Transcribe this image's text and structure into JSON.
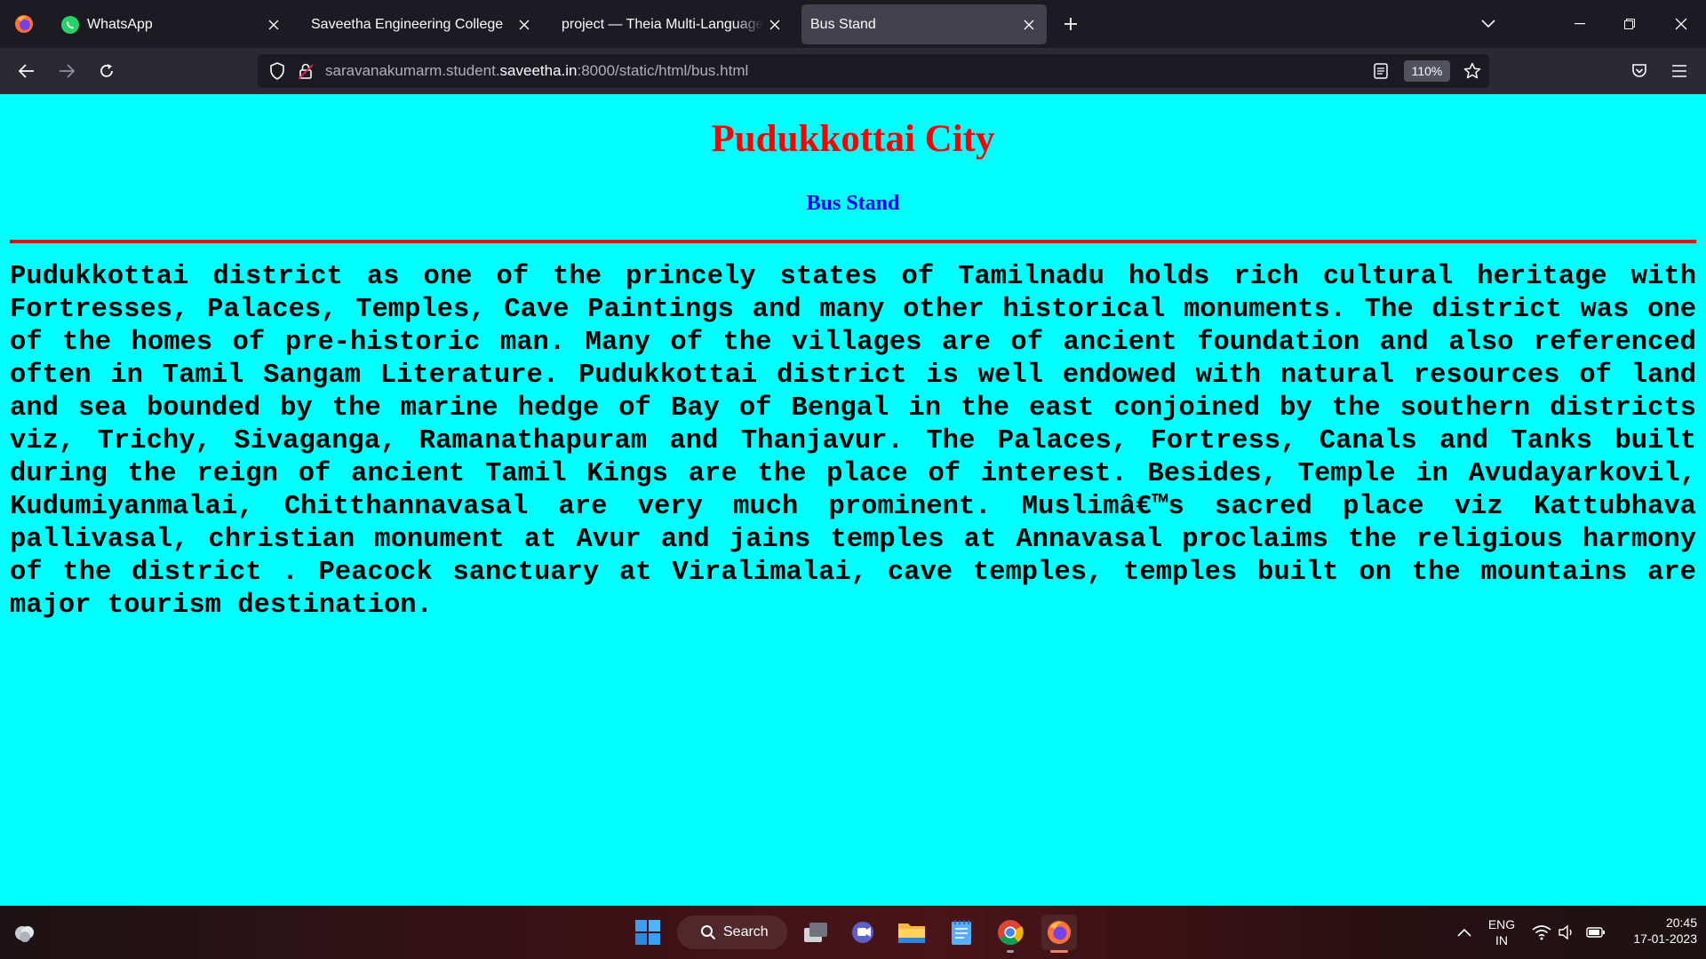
{
  "browser": {
    "tabs": [
      {
        "title": "WhatsApp",
        "favicon": "whatsapp-icon",
        "active": false
      },
      {
        "title": "Saveetha Engineering College",
        "favicon": "none",
        "active": false
      },
      {
        "title": "project — Theia Multi-Language Ex",
        "favicon": "none",
        "active": false
      },
      {
        "title": "Bus Stand",
        "favicon": "none",
        "active": true
      }
    ],
    "url": {
      "prefix": "saravanakumarm.student.",
      "host": "saveetha.in",
      "suffix": ":8000/static/html/bus.html"
    },
    "zoom": "110%"
  },
  "page": {
    "background": "#00ffff",
    "heading": "Pudukkottai City",
    "heading_color": "#ff0000",
    "subheading": "Bus Stand",
    "subheading_color": "#0000ff",
    "rule_color": "#ff0000",
    "paragraph": "Pudukkottai district as one of the princely states of Tamilnadu holds rich cultural heritage with Fortresses, Palaces, Temples, Cave Paintings and many other historical monuments. The district was one of the homes of pre-historic man. Many of the villages are of ancient foundation and also referenced often in Tamil Sangam Literature. Pudukkottai district is well endowed with natural resources of land and sea bounded by the marine hedge of Bay of Bengal in the east conjoined by the southern districts viz, Trichy, Sivaganga, Ramanathapuram and Thanjavur. The Palaces, Fortress, Canals and Tanks built during the reign of ancient Tamil Kings are the place of interest. Besides, Temple in Avudayarkovil, Kudumiyanmalai, Chitthannavasal are very much prominent. Muslimâ€™s sacred place viz Kattubhava pallivasal, christian monument at Avur and jains temples at Annavasal proclaims the religious harmony of the district . Peacock sanctuary at Viralimalai, cave temples, temples built on the mountains are major tourism destination."
  },
  "taskbar": {
    "search_label": "Search",
    "language_line1": "ENG",
    "language_line2": "IN",
    "time": "20:45",
    "date": "17-01-2023",
    "pinned": [
      "widgets-icon",
      "start-icon",
      "search-icon",
      "task-view-icon",
      "teams-chat-icon",
      "file-explorer-icon",
      "notepad-icon",
      "chrome-icon",
      "firefox-icon"
    ]
  }
}
